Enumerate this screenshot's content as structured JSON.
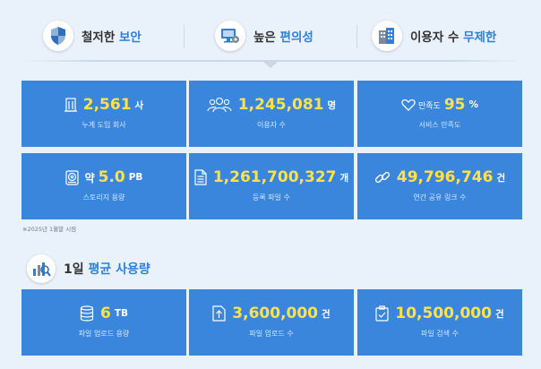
{
  "features": [
    {
      "label_plain": "철저한",
      "label_hl": "보안",
      "icon": "shield-icon"
    },
    {
      "label_plain": "높은",
      "label_hl": "편의성",
      "icon": "monitor-gear-icon"
    },
    {
      "label_plain": "이용자 수",
      "label_hl": "무제한",
      "icon": "buildings-icon"
    }
  ],
  "stats": [
    {
      "icon": "building-icon",
      "pre": "",
      "value": "2,561",
      "unit": "사",
      "sub": "누계 도입 회사"
    },
    {
      "icon": "users-icon",
      "pre": "",
      "value": "1,245,081",
      "unit": "명",
      "sub": "이용자 수"
    },
    {
      "icon": "heart-icon",
      "pre": "만족도",
      "value": "95",
      "unit": "%",
      "sub": "서비스 만족도"
    },
    {
      "icon": "storage-icon",
      "pre": "약",
      "value": "5.0",
      "unit": "PB",
      "sub": "스토리지 용량"
    },
    {
      "icon": "file-icon",
      "pre": "",
      "value": "1,261,700,327",
      "unit": "개",
      "sub": "등록 파일 수"
    },
    {
      "icon": "link-icon",
      "pre": "",
      "value": "49,796,746",
      "unit": "건",
      "sub": "연간 공유 링크 수"
    }
  ],
  "footnote": "※2025년 1월말 시점",
  "section": {
    "plain": "1일",
    "hl": "평균 사용량",
    "icon": "analytics-icon"
  },
  "daily": [
    {
      "icon": "database-icon",
      "value": "6",
      "unit": "TB",
      "sub": "파일 업로드 용량"
    },
    {
      "icon": "upload-icon",
      "value": "3,600,000",
      "unit": "건",
      "sub": "파일 업로드 수"
    },
    {
      "icon": "file-check-icon",
      "value": "10,500,000",
      "unit": "건",
      "sub": "파일 검색 수"
    }
  ]
}
